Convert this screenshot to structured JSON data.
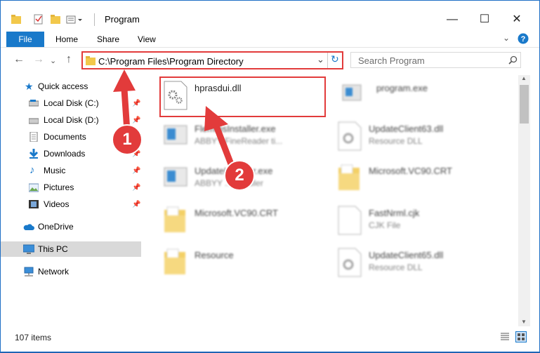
{
  "window": {
    "title": "Program"
  },
  "ribbon": {
    "file": "File",
    "home": "Home",
    "share": "Share",
    "view": "View"
  },
  "address": {
    "path": "C:\\Program Files\\Program Directory"
  },
  "search": {
    "placeholder": "Search Program"
  },
  "sidebar": {
    "quick_access": "Quick access",
    "items": [
      {
        "label": "Local Disk (C:)"
      },
      {
        "label": "Local Disk (D:)"
      },
      {
        "label": "Documents"
      },
      {
        "label": "Downloads"
      },
      {
        "label": "Music"
      },
      {
        "label": "Pictures"
      },
      {
        "label": "Videos"
      }
    ],
    "onedrive": "OneDrive",
    "this_pc": "This PC",
    "network": "Network"
  },
  "files": [
    {
      "name": "hprasdui.dll",
      "sub": ""
    },
    {
      "name": "program.exe",
      "sub": ""
    },
    {
      "name": "FlemmsInstaller.exe",
      "sub": "ABBYY FineReader ti..."
    },
    {
      "name": "UpdateClient63.dll",
      "sub": "Resource DLL"
    },
    {
      "name": "UpdateInstaller.exe",
      "sub": "ABBYY ... installer"
    },
    {
      "name": "Microsoft.VC90.CRT",
      "sub": ""
    },
    {
      "name": "Microsoft.VC90.CRT",
      "sub": ""
    },
    {
      "name": "FastNrml.cjk",
      "sub": "CJK File"
    },
    {
      "name": "Resource",
      "sub": ""
    },
    {
      "name": "UpdateClient65.dll",
      "sub": "Resource DLL"
    }
  ],
  "status": {
    "count": "107 items"
  },
  "annotations": {
    "one": "1",
    "two": "2"
  },
  "colors": {
    "accent": "#1979ca",
    "annotation": "#e23b3b"
  }
}
